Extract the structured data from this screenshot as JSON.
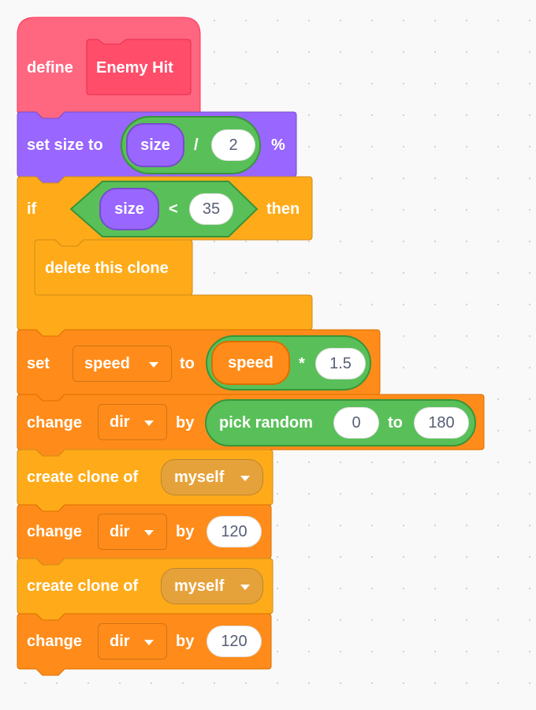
{
  "colors": {
    "my_block": "#ff6680",
    "looks": "#9966ff",
    "control": "#ffab19",
    "variables": "#ff8c1a",
    "operators": "#59c059",
    "canvas": "#f9f9f9"
  },
  "define_block": {
    "keyword": "define",
    "name": "Enemy Hit"
  },
  "set_size_block": {
    "label": "set size to",
    "reporter": "size",
    "operator": "/",
    "operand": "2",
    "suffix": "%"
  },
  "if_block": {
    "keyword": "if",
    "reporter": "size",
    "operator": "<",
    "operand": "35",
    "then_label": "then",
    "inner_block": "delete this clone"
  },
  "set_var_block": {
    "keyword": "set",
    "variable": "speed",
    "to_label": "to",
    "reporter": "speed",
    "operator": "*",
    "operand": "1.5"
  },
  "change_dir_random": {
    "keyword": "change",
    "variable": "dir",
    "by_label": "by",
    "random_label": "pick random",
    "from": "0",
    "to_label": "to",
    "to": "180"
  },
  "create_clone_1": {
    "label": "create clone of",
    "target": "myself"
  },
  "change_dir_1": {
    "keyword": "change",
    "variable": "dir",
    "by_label": "by",
    "value": "120"
  },
  "create_clone_2": {
    "label": "create clone of",
    "target": "myself"
  },
  "change_dir_2": {
    "keyword": "change",
    "variable": "dir",
    "by_label": "by",
    "value": "120"
  }
}
